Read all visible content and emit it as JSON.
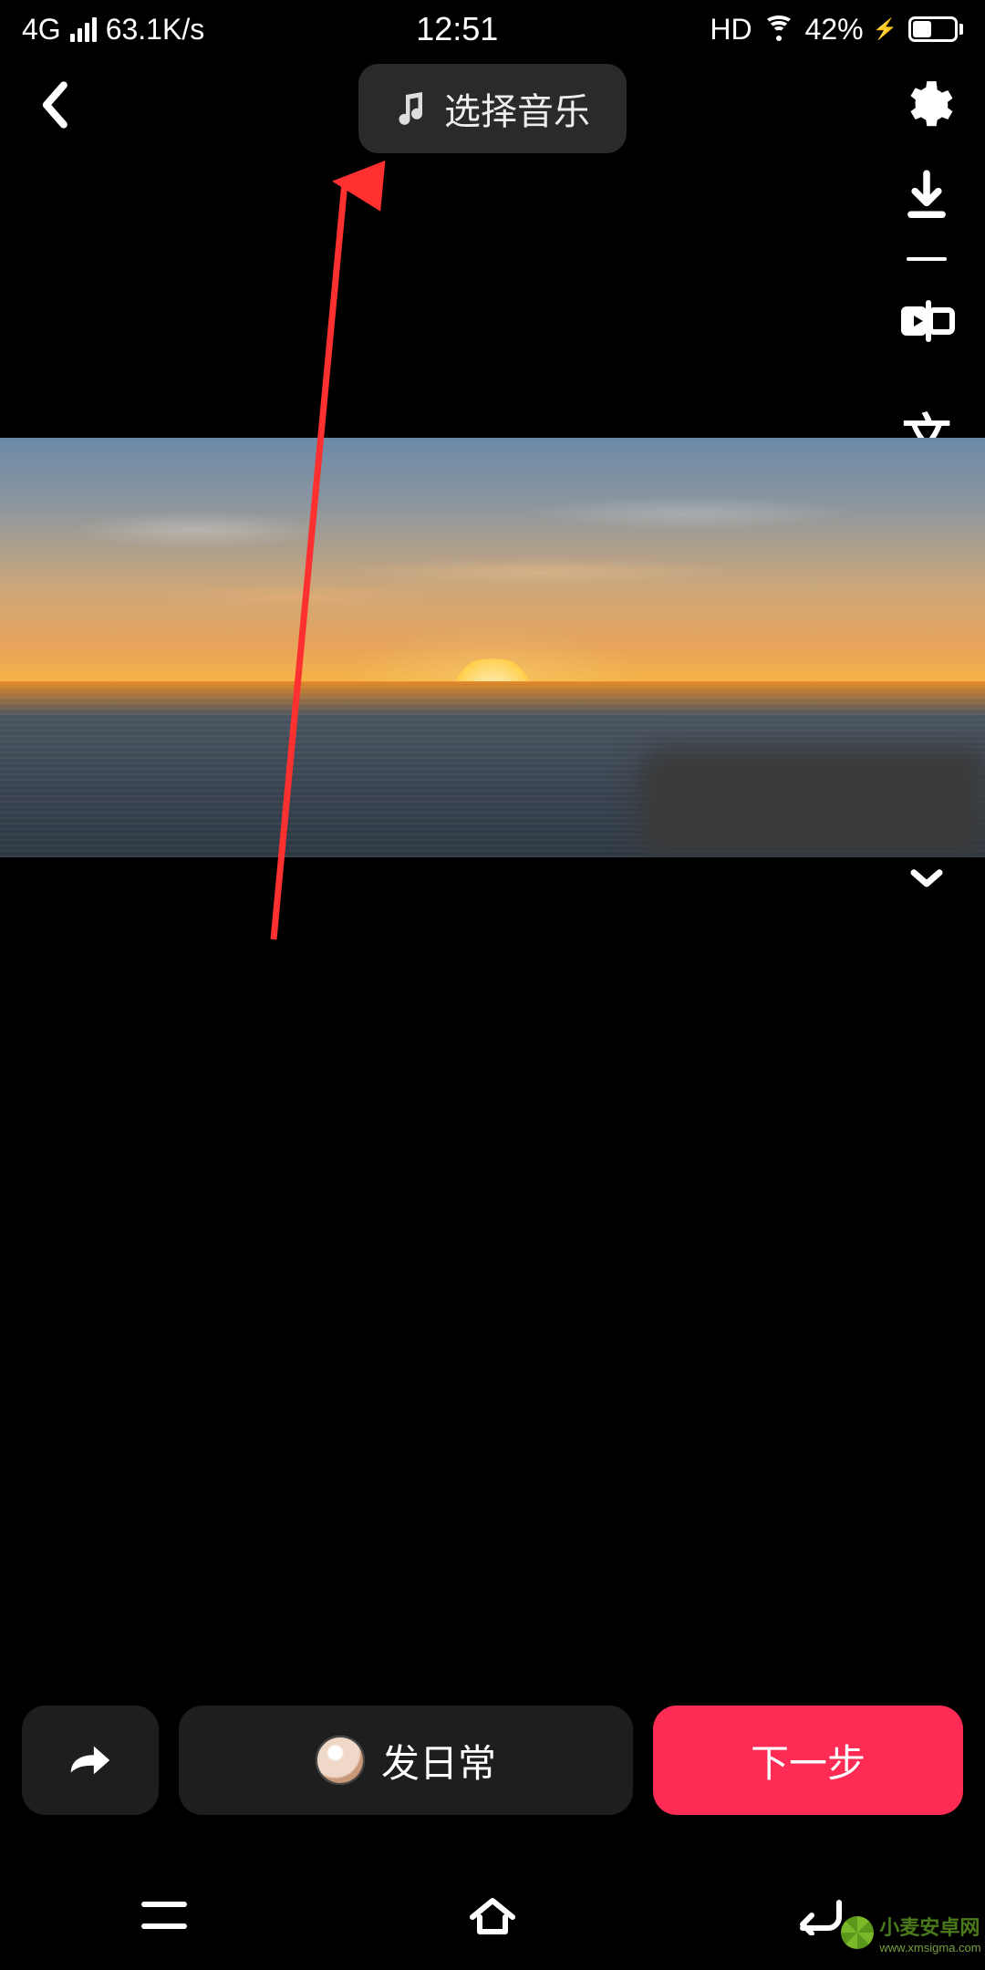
{
  "status": {
    "network_type": "4G",
    "data_rate": "63.1K/s",
    "time": "12:51",
    "hd_label": "HD",
    "battery_pct": "42%"
  },
  "topbar": {
    "music_label": "选择音乐"
  },
  "side_tools": {
    "text_glyph": "文"
  },
  "bottom": {
    "daily_label": "发日常",
    "next_label": "下一步"
  },
  "watermark": {
    "title": "小麦安卓网",
    "sub": "www.xmsigma.com"
  },
  "icons": {
    "back": "back-icon",
    "music": "music-note-icon",
    "settings": "gear-icon",
    "download": "download-icon",
    "clip": "clip-icon",
    "text": "text-icon",
    "sticker": "sticker-icon",
    "effect": "effect-icon",
    "sparkle": "sparkle-icon",
    "expand": "chevron-down-icon",
    "share": "share-arrow-icon",
    "nav_menu": "menu-icon",
    "nav_home": "home-icon",
    "nav_back": "return-icon"
  }
}
